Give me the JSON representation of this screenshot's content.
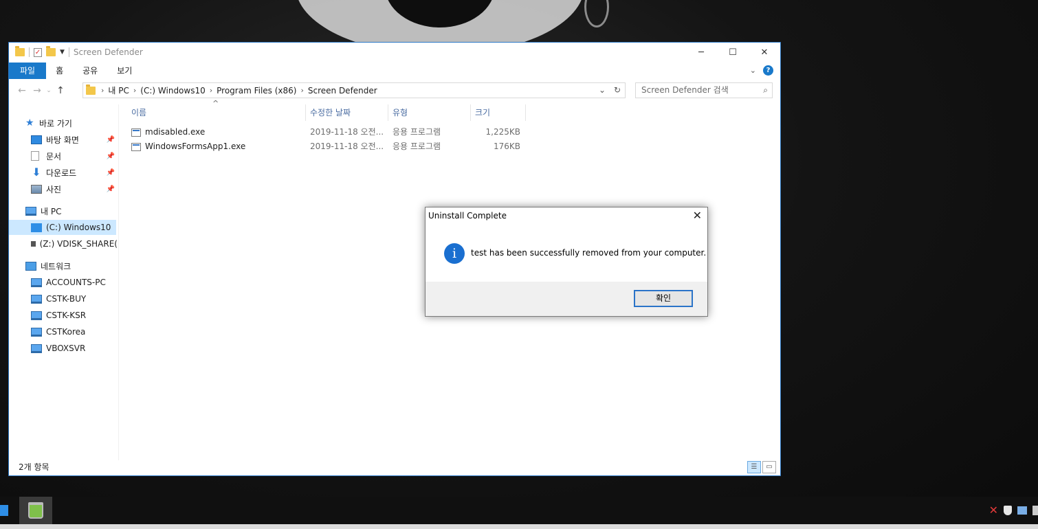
{
  "window": {
    "title": "Screen Defender",
    "controls": {
      "minimize": "─",
      "maximize": "☐",
      "close": "✕"
    }
  },
  "ribbon": {
    "tabs": [
      "파일",
      "홈",
      "공유",
      "보기"
    ],
    "help": "?"
  },
  "address": {
    "crumbs": [
      "내 PC",
      "(C:) Windows10",
      "Program Files (x86)",
      "Screen Defender"
    ],
    "search_placeholder": "Screen Defender 검색"
  },
  "navpane": {
    "quick_access": "바로 가기",
    "quick_items": [
      "바탕 화면",
      "문서",
      "다운로드",
      "사진"
    ],
    "this_pc": "내 PC",
    "drives": [
      "(C:) Windows10",
      "(Z:) VDISK_SHARE("
    ],
    "network": "네트워크",
    "network_items": [
      "ACCOUNTS-PC",
      "CSTK-BUY",
      "CSTK-KSR",
      "CSTKorea",
      "VBOXSVR"
    ]
  },
  "list": {
    "columns": [
      "이름",
      "수정한 날짜",
      "유형",
      "크기"
    ],
    "rows": [
      {
        "name": "mdisabled.exe",
        "date": "2019-11-18 오전...",
        "type": "응용 프로그램",
        "size": "1,225KB"
      },
      {
        "name": "WindowsFormsApp1.exe",
        "date": "2019-11-18 오전...",
        "type": "응용 프로그램",
        "size": "176KB"
      }
    ]
  },
  "status": {
    "count": "2개 항목"
  },
  "dialog": {
    "title": "Uninstall Complete",
    "message": "test has been successfully removed from your computer.",
    "ok": "확인",
    "icon": "i"
  },
  "colors": {
    "accent": "#1979ca",
    "selection": "#cce8ff"
  }
}
